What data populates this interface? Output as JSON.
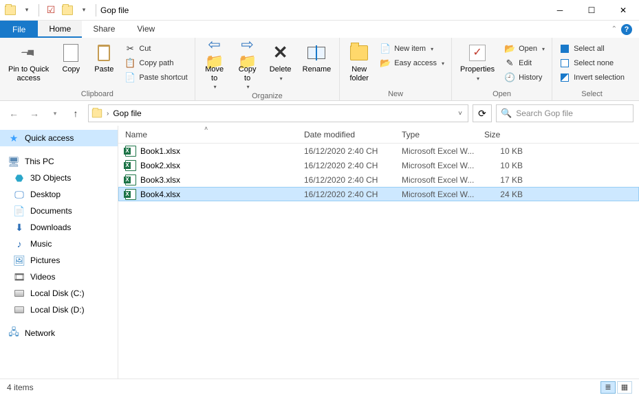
{
  "title": "Gop file",
  "tabs": {
    "file": "File",
    "home": "Home",
    "share": "Share",
    "view": "View"
  },
  "ribbon": {
    "clipboard": {
      "label": "Clipboard",
      "pin": "Pin to Quick\naccess",
      "copy": "Copy",
      "paste": "Paste",
      "cut": "Cut",
      "copy_path": "Copy path",
      "paste_shortcut": "Paste shortcut"
    },
    "organize": {
      "label": "Organize",
      "move_to": "Move\nto",
      "copy_to": "Copy\nto",
      "delete": "Delete",
      "rename": "Rename"
    },
    "new": {
      "label": "New",
      "new_folder": "New\nfolder",
      "new_item": "New item",
      "easy_access": "Easy access"
    },
    "open": {
      "label": "Open",
      "properties": "Properties",
      "open": "Open",
      "edit": "Edit",
      "history": "History"
    },
    "select": {
      "label": "Select",
      "select_all": "Select all",
      "select_none": "Select none",
      "invert": "Invert selection"
    }
  },
  "address": {
    "folder": "Gop file"
  },
  "search": {
    "placeholder": "Search Gop file"
  },
  "sidebar": {
    "quick_access": "Quick access",
    "this_pc": "This PC",
    "items": [
      "3D Objects",
      "Desktop",
      "Documents",
      "Downloads",
      "Music",
      "Pictures",
      "Videos",
      "Local Disk (C:)",
      "Local Disk (D:)"
    ],
    "network": "Network"
  },
  "columns": {
    "name": "Name",
    "date": "Date modified",
    "type": "Type",
    "size": "Size"
  },
  "files": [
    {
      "name": "Book1.xlsx",
      "date": "16/12/2020 2:40 CH",
      "type": "Microsoft Excel W...",
      "size": "10 KB"
    },
    {
      "name": "Book2.xlsx",
      "date": "16/12/2020 2:40 CH",
      "type": "Microsoft Excel W...",
      "size": "10 KB"
    },
    {
      "name": "Book3.xlsx",
      "date": "16/12/2020 2:40 CH",
      "type": "Microsoft Excel W...",
      "size": "17 KB"
    },
    {
      "name": "Book4.xlsx",
      "date": "16/12/2020 2:40 CH",
      "type": "Microsoft Excel W...",
      "size": "24 KB"
    }
  ],
  "selected_index": 3,
  "status": {
    "count": "4 items"
  }
}
